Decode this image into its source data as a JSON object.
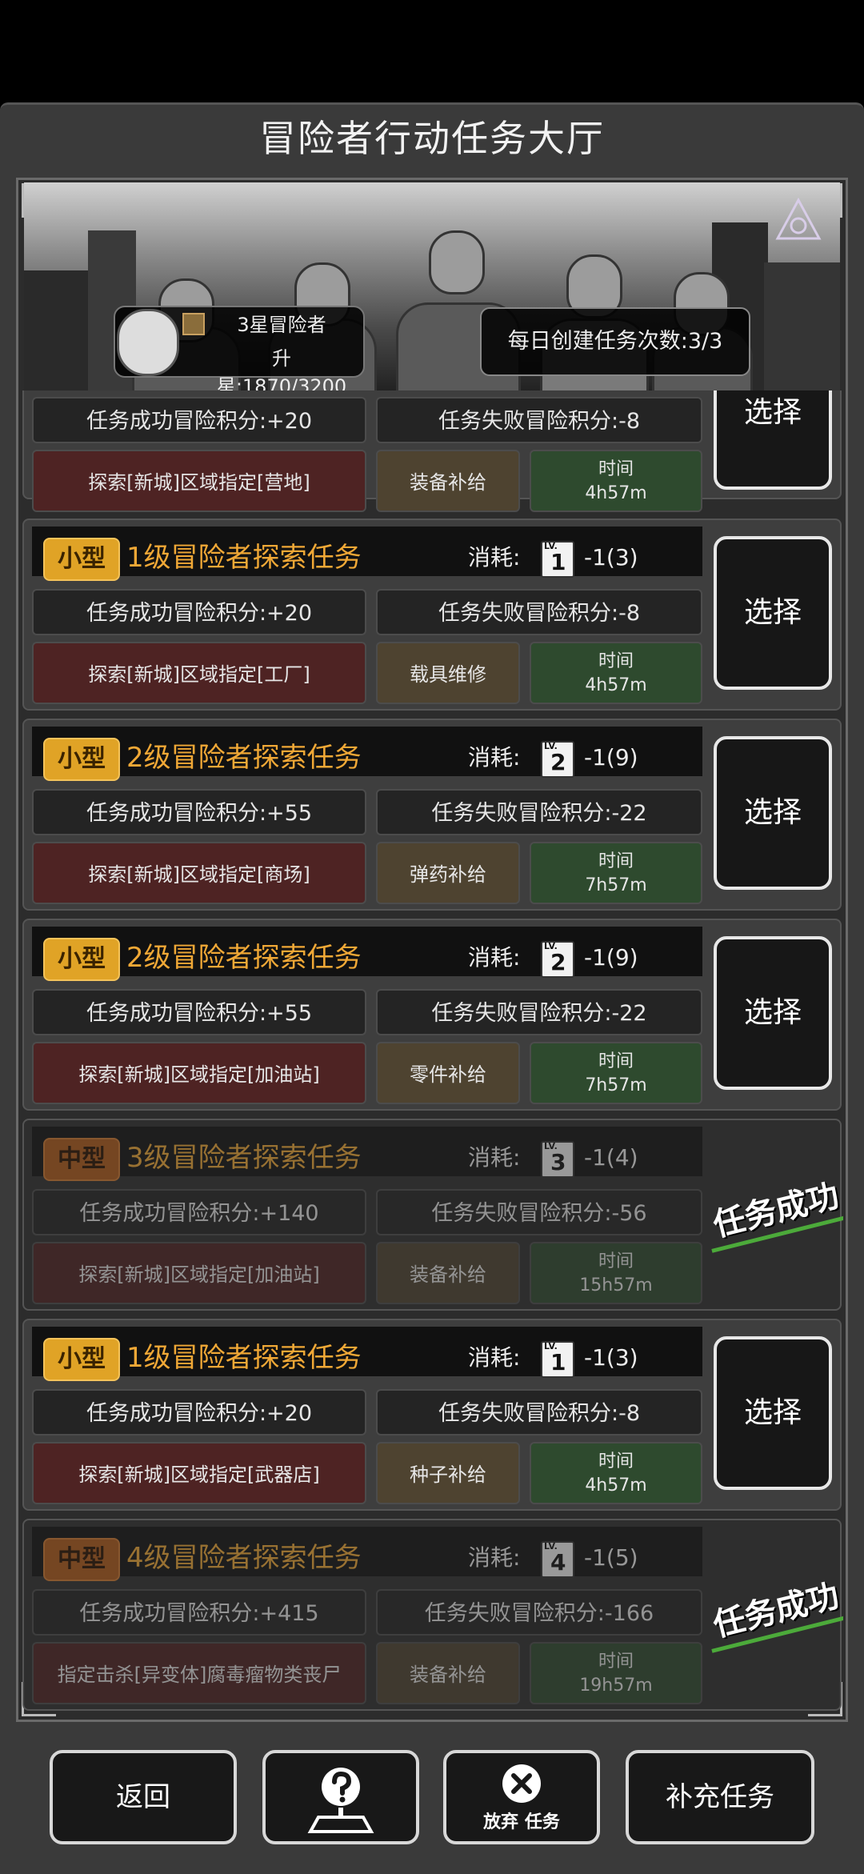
{
  "title": "冒险者行动任务大厅",
  "profile": {
    "rank_name": "3星冒险者",
    "upgrade_progress": "升星:1870/3200"
  },
  "daily": {
    "label": "每日创建任务次数:3/3"
  },
  "common": {
    "cost_label": "消耗:",
    "time_label": "时间",
    "select_label": "选择",
    "success_stamp": "任务成功",
    "lv_text": "LV."
  },
  "tasks": [
    {
      "tag": "",
      "name": "",
      "lv": "",
      "cost": "",
      "success_points": "任务成功冒险积分:+20",
      "fail_points": "任务失败冒险积分:-8",
      "explore": "探索[新城]区域指定[营地]",
      "supply": "装备补给",
      "time": "4h57m",
      "status": "available"
    },
    {
      "tag": "小型",
      "name": "1级冒险者探索任务",
      "lv": "1",
      "cost": "-1(3)",
      "success_points": "任务成功冒险积分:+20",
      "fail_points": "任务失败冒险积分:-8",
      "explore": "探索[新城]区域指定[工厂]",
      "supply": "载具维修",
      "time": "4h57m",
      "status": "available"
    },
    {
      "tag": "小型",
      "name": "2级冒险者探索任务",
      "lv": "2",
      "cost": "-1(9)",
      "success_points": "任务成功冒险积分:+55",
      "fail_points": "任务失败冒险积分:-22",
      "explore": "探索[新城]区域指定[商场]",
      "supply": "弹药补给",
      "time": "7h57m",
      "status": "available"
    },
    {
      "tag": "小型",
      "name": "2级冒险者探索任务",
      "lv": "2",
      "cost": "-1(9)",
      "success_points": "任务成功冒险积分:+55",
      "fail_points": "任务失败冒险积分:-22",
      "explore": "探索[新城]区域指定[加油站]",
      "supply": "零件补给",
      "time": "7h57m",
      "status": "available"
    },
    {
      "tag": "中型",
      "name": "3级冒险者探索任务",
      "lv": "3",
      "cost": "-1(4)",
      "success_points": "任务成功冒险积分:+140",
      "fail_points": "任务失败冒险积分:-56",
      "explore": "探索[新城]区域指定[加油站]",
      "supply": "装备补给",
      "time": "15h57m",
      "status": "success"
    },
    {
      "tag": "小型",
      "name": "1级冒险者探索任务",
      "lv": "1",
      "cost": "-1(3)",
      "success_points": "任务成功冒险积分:+20",
      "fail_points": "任务失败冒险积分:-8",
      "explore": "探索[新城]区域指定[武器店]",
      "supply": "种子补给",
      "time": "4h57m",
      "status": "available"
    },
    {
      "tag": "中型",
      "name": "4级冒险者探索任务",
      "lv": "4",
      "cost": "-1(5)",
      "success_points": "任务成功冒险积分:+415",
      "fail_points": "任务失败冒险积分:-166",
      "explore": "指定击杀[异变体]腐毒瘤物类丧尸",
      "supply": "装备补给",
      "time": "19h57m",
      "status": "success"
    }
  ],
  "bottom": {
    "back": "返回",
    "abandon_a": "放弃",
    "abandon_b": "任务",
    "refill": "补充任务"
  },
  "colors": {
    "accent": "#f0a836",
    "success_line": "#4caa3a"
  }
}
